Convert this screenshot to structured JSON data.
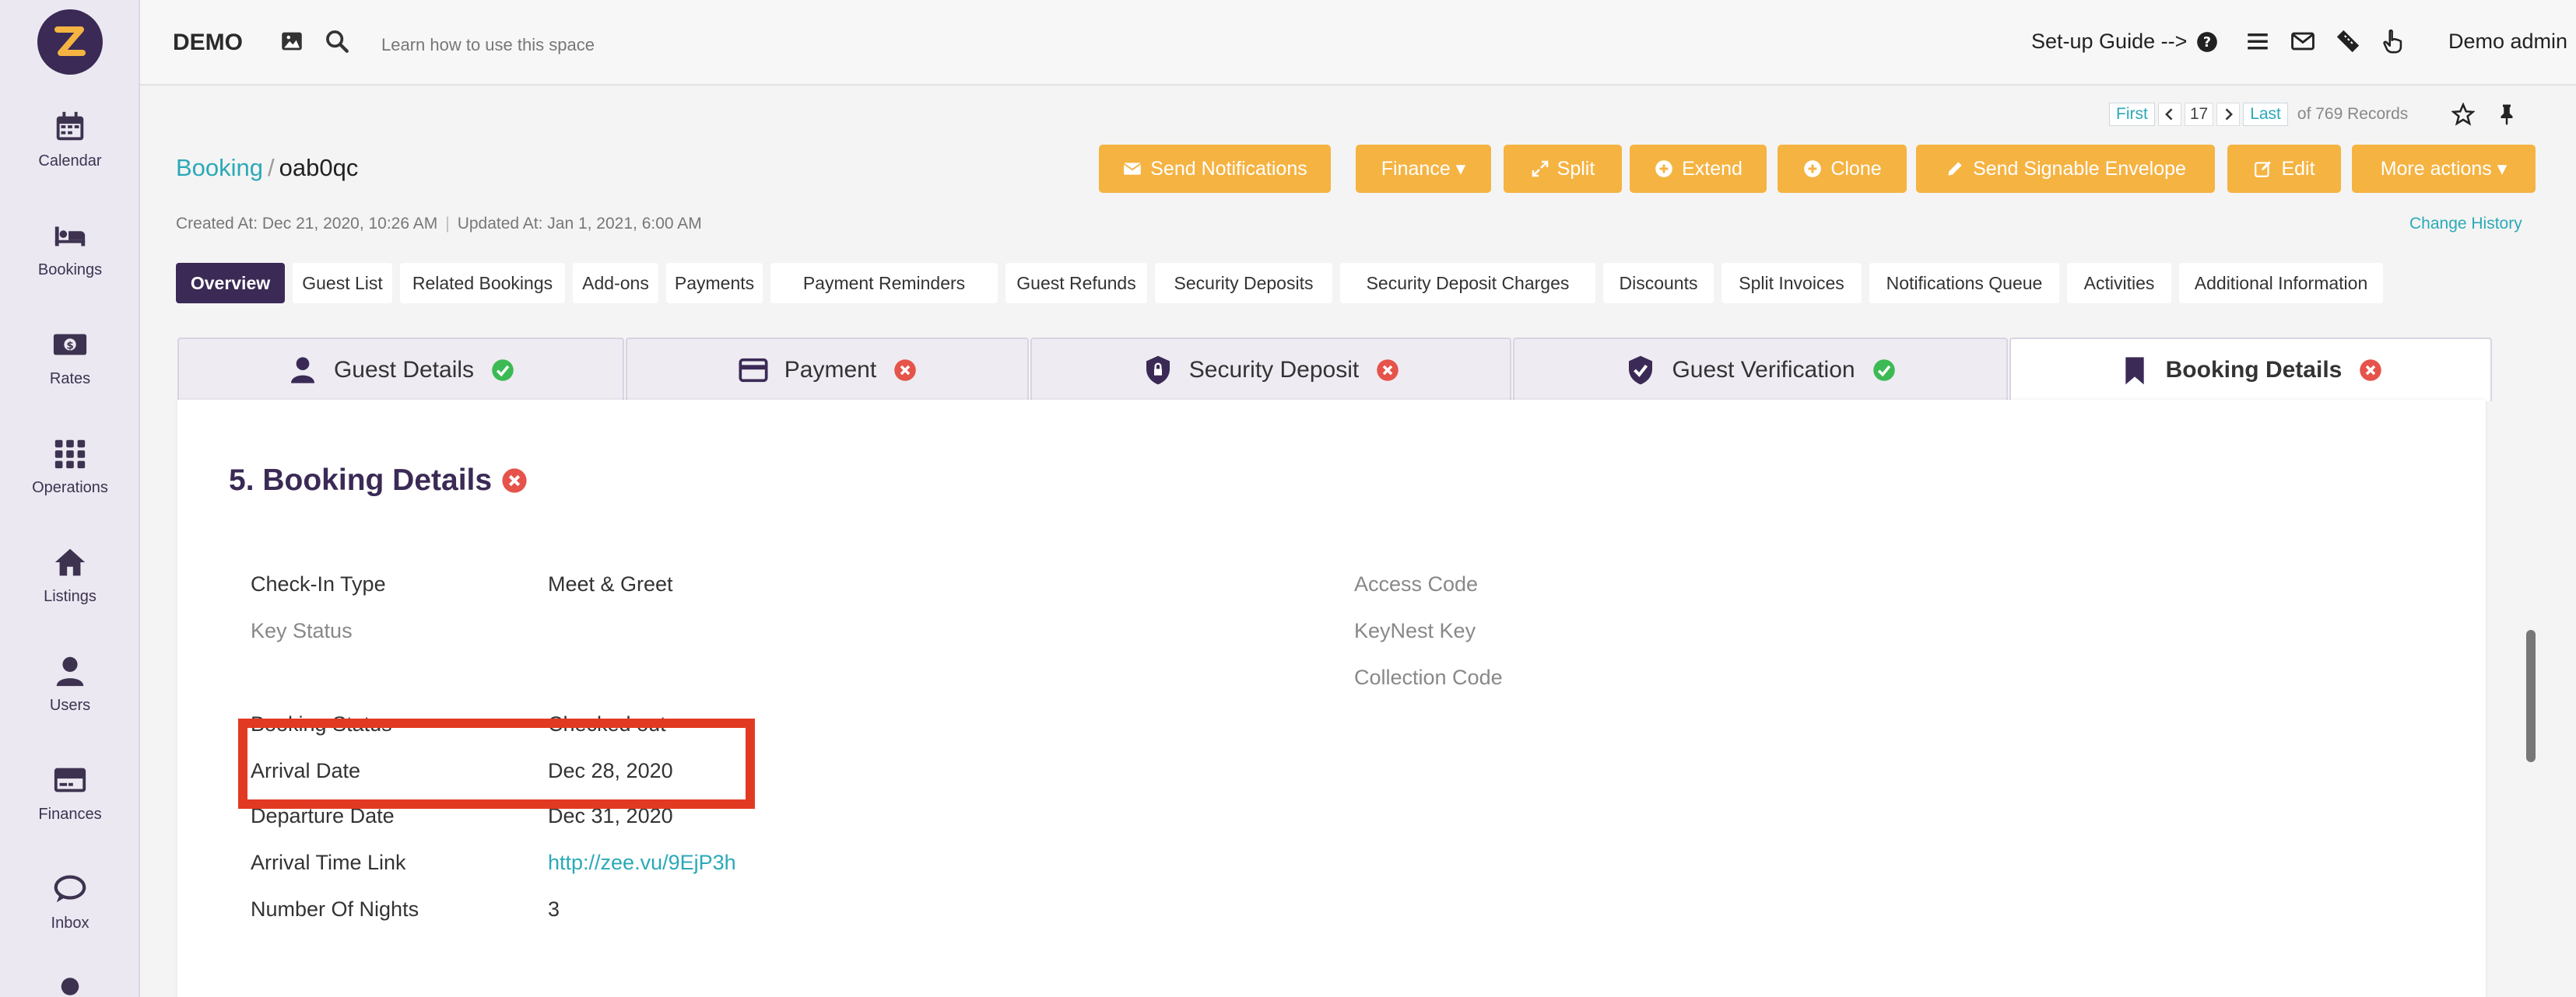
{
  "app": {
    "space_name": "DEMO",
    "learn_text": "Learn how to use this space",
    "setup_guide": "Set-up Guide -->",
    "user": "Demo admin"
  },
  "sidebar": {
    "items": [
      {
        "label": "Calendar",
        "icon": "calendar-icon"
      },
      {
        "label": "Bookings",
        "icon": "bed-icon"
      },
      {
        "label": "Rates",
        "icon": "money-icon"
      },
      {
        "label": "Operations",
        "icon": "grid-icon"
      },
      {
        "label": "Listings",
        "icon": "home-icon"
      },
      {
        "label": "Users",
        "icon": "user-icon"
      },
      {
        "label": "Finances",
        "icon": "credit-card-icon"
      },
      {
        "label": "Inbox",
        "icon": "chat-icon"
      }
    ]
  },
  "pager": {
    "first": "First",
    "current": "17",
    "last": "Last",
    "records": "of 769 Records"
  },
  "breadcrumb": {
    "parent": "Booking",
    "separator": "/",
    "record": "oab0qc"
  },
  "actions": {
    "send_notifications": "Send Notifications",
    "finance": "Finance ▾",
    "split": "Split",
    "extend": "Extend",
    "clone": "Clone",
    "send_envelope": "Send Signable Envelope",
    "edit": "Edit",
    "more": "More actions ▾"
  },
  "meta": {
    "created": "Created At: Dec 21, 2020, 10:26 AM",
    "updated": "Updated At: Jan 1, 2021, 6:00 AM",
    "change_history": "Change History"
  },
  "tabs": [
    "Overview",
    "Guest List",
    "Related Bookings",
    "Add-ons",
    "Payments",
    "Payment Reminders",
    "Guest Refunds",
    "Security Deposits",
    "Security Deposit Charges",
    "Discounts",
    "Split Invoices",
    "Notifications Queue",
    "Activities",
    "Additional Information"
  ],
  "steps": [
    {
      "label": "Guest Details",
      "status": "complete"
    },
    {
      "label": "Payment",
      "status": "incomplete"
    },
    {
      "label": "Security Deposit",
      "status": "incomplete"
    },
    {
      "label": "Guest Verification",
      "status": "complete"
    },
    {
      "label": "Booking Details",
      "status": "incomplete"
    }
  ],
  "section": {
    "title": "5. Booking Details",
    "left_fields": [
      {
        "key": "Check-In Type",
        "value": "Meet & Greet"
      },
      {
        "key": "Key Status",
        "value": ""
      },
      {
        "key": "Booking Status",
        "value": "Checked out"
      },
      {
        "key": "Arrival Date",
        "value": "Dec 28, 2020"
      },
      {
        "key": "Departure Date",
        "value": "Dec 31, 2020"
      },
      {
        "key": "Arrival Time Link",
        "value": "http://zee.vu/9EjP3h"
      },
      {
        "key": "Number Of Nights",
        "value": "3"
      }
    ],
    "right_fields": [
      {
        "key": "Access Code"
      },
      {
        "key": "KeyNest Key"
      },
      {
        "key": "Collection Code"
      }
    ]
  },
  "colors": {
    "accent": "#2aa9b8",
    "brand": "#3a2a55",
    "button": "#f5b342",
    "success": "#3cba54",
    "danger": "#e5534b",
    "highlight": "#e23a22"
  }
}
